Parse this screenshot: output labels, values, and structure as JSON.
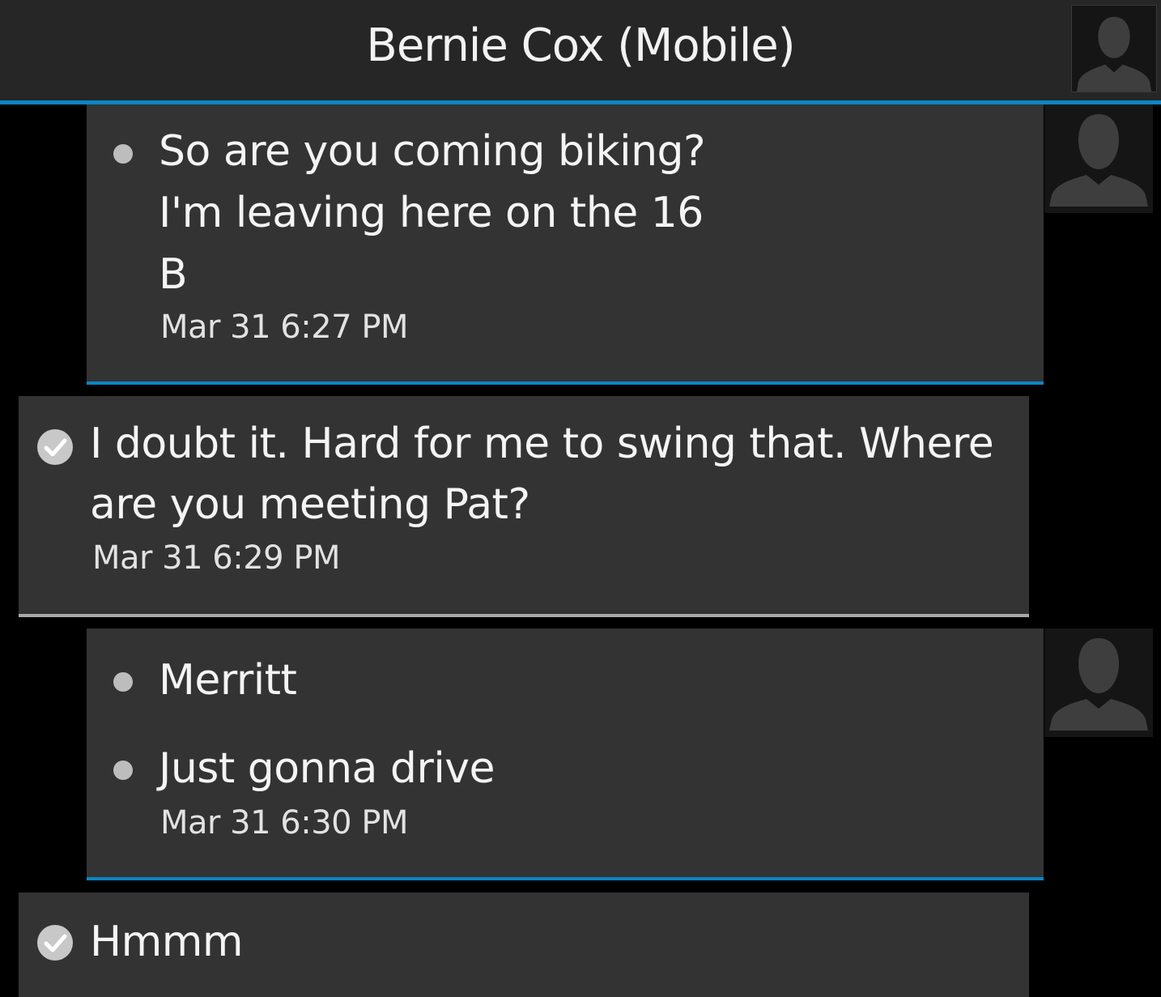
{
  "header": {
    "title": "Bernie Cox (Mobile)",
    "avatar_icon": "contact-silhouette-icon"
  },
  "messages": [
    {
      "direction": "incoming",
      "lines": [
        "So are you coming biking?",
        "I'm leaving here on the 16",
        "B"
      ],
      "time": "Mar 31 6:27 PM"
    },
    {
      "direction": "outgoing",
      "status": "delivered",
      "lines": [
        "I doubt it. Hard for me to swing that. Where",
        "are you meeting Pat?"
      ],
      "time": "Mar 31 6:29 PM"
    },
    {
      "direction": "incoming",
      "lines": [
        "Merritt",
        "Just gonna drive"
      ],
      "time": "Mar 31 6:30 PM"
    },
    {
      "direction": "outgoing",
      "status": "delivered",
      "lines": [
        "Hmmm"
      ]
    }
  ],
  "colors": {
    "accent": "#0a86c4",
    "bubble": "#333333",
    "header": "#262626",
    "background": "#000000",
    "outgoing_border": "#a8a8a8"
  }
}
